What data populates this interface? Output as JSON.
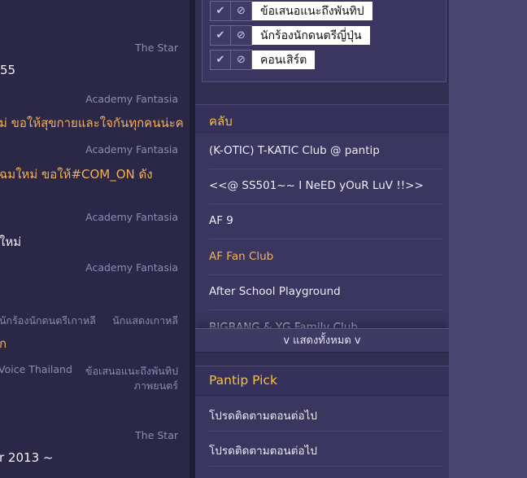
{
  "feed": {
    "items": [
      {
        "tag": "The Star"
      },
      {
        "title": "55"
      },
      {
        "tag": "Academy Fantasia"
      },
      {
        "title": "ม่ ขอให้สุขกายและใจกันทุกคนน่ะค"
      },
      {
        "tag": "Academy Fantasia"
      },
      {
        "title": "ฉมใหม่ ขอให้#COM_ON ดัง"
      },
      {
        "tag": "Academy Fantasia"
      },
      {
        "title": "ใหม่"
      },
      {
        "tag": "Academy Fantasia"
      },
      {
        "tag_a": "นักร้องนักดนตรีเกาหลี",
        "tag_b": "นักแสดงเกาหลี"
      },
      {
        "title": "ก"
      },
      {
        "tag_a": "Voice Thailand",
        "tag_b": "ข้อเสนอแนะถึงพันทิป",
        "tag_c": "ภาพยนตร์"
      },
      {
        "tag": "The Star"
      },
      {
        "title": "r 2013 ~"
      }
    ]
  },
  "topics": [
    {
      "label": "ข้อเสนอแนะถึงพันทิป"
    },
    {
      "label": "นักร้องนักดนตรีญี่ปุ่น"
    },
    {
      "label": "คอนเสิร์ต"
    }
  ],
  "clubs": {
    "title": "คลับ",
    "items": [
      "(K-OTIC) T-KATIC Club @ pantip",
      "<<@ SS501~~ I NeED yOuR LuV !!>>",
      "AF 9",
      "AF Fan Club",
      "After School Playground",
      "BIGBANG & YG Family Club"
    ],
    "show_all": "v แสดงทั้งหมด v"
  },
  "pick": {
    "title": "Pantip Pick",
    "items": [
      "โปรดติดตามตอนต่อไป",
      "โปรดติดตามตอนต่อไป"
    ]
  },
  "colors": {
    "accent": "#f7c13b",
    "orange": "#f2b05a",
    "panel": "#3a3660",
    "bg": "#4a4670"
  }
}
